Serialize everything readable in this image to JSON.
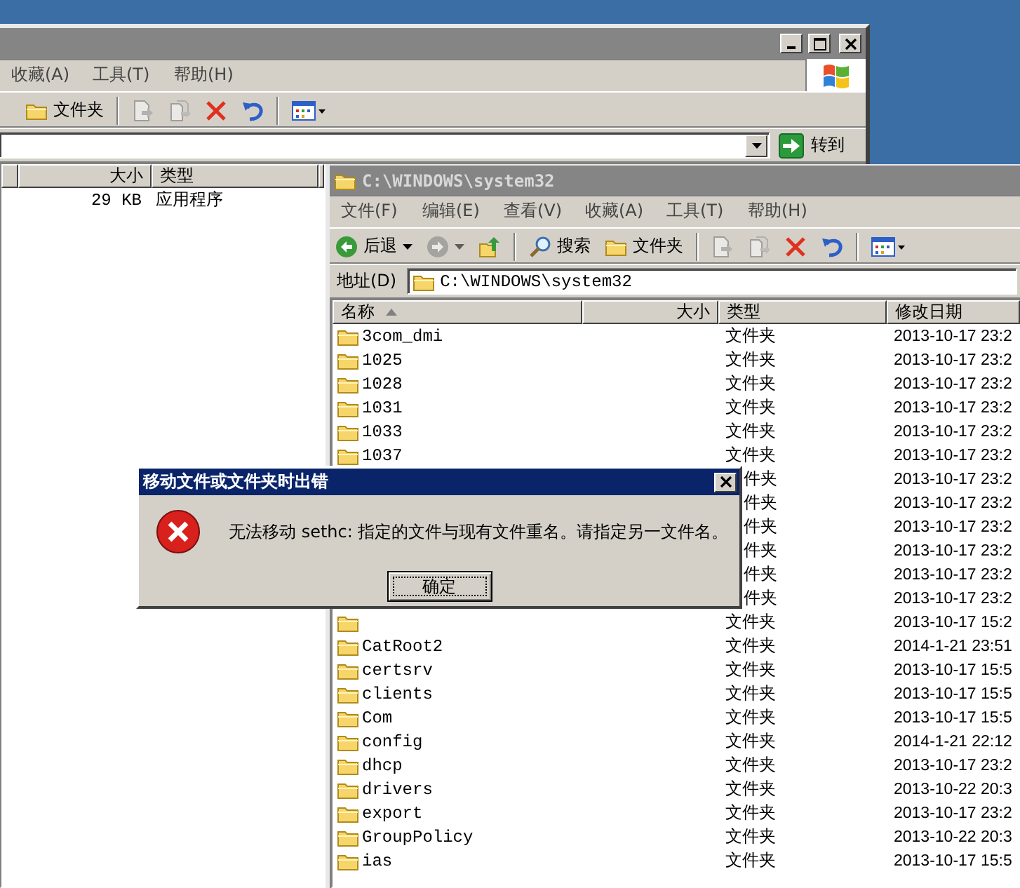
{
  "back_window": {
    "menus": [
      "收藏(A)",
      "工具(T)",
      "帮助(H)"
    ],
    "toolbar": [
      [
        {
          "kind": "folders",
          "label": "文件夹",
          "disabled": false
        }
      ],
      [
        {
          "kind": "move-to",
          "disabled": true
        },
        {
          "kind": "copy-to",
          "disabled": true
        },
        {
          "kind": "delete",
          "disabled": false
        },
        {
          "kind": "undo",
          "disabled": false
        }
      ],
      [
        {
          "kind": "views",
          "disabled": false
        }
      ]
    ],
    "go_button": "转到",
    "columns": [
      "大小",
      "类型"
    ],
    "rows": [
      {
        "size": "29 KB",
        "type": "应用程序"
      }
    ]
  },
  "window": {
    "title": "C:\\WINDOWS\\system32",
    "menus": [
      "文件(F)",
      "编辑(E)",
      "查看(V)",
      "收藏(A)",
      "工具(T)",
      "帮助(H)"
    ],
    "toolbar": [
      [
        {
          "kind": "back",
          "label": "后退",
          "disabled": false
        },
        {
          "kind": "forward",
          "disabled": true
        },
        {
          "kind": "up",
          "disabled": false
        }
      ],
      [
        {
          "kind": "search",
          "label": "搜索",
          "disabled": false
        },
        {
          "kind": "folders",
          "label": "文件夹",
          "disabled": false
        }
      ],
      [
        {
          "kind": "move-to",
          "disabled": true
        },
        {
          "kind": "copy-to",
          "disabled": true
        },
        {
          "kind": "delete",
          "disabled": false
        },
        {
          "kind": "undo",
          "disabled": false
        }
      ],
      [
        {
          "kind": "views",
          "disabled": false
        }
      ]
    ],
    "address_label": "地址(D)",
    "address": "C:\\WINDOWS\\system32",
    "columns": [
      {
        "label": "名称",
        "sorted": true
      },
      {
        "label": "大小",
        "sorted": false
      },
      {
        "label": "类型",
        "sorted": false
      },
      {
        "label": "修改日期",
        "sorted": false
      }
    ],
    "rows": [
      {
        "kind": "folder",
        "name": "3com_dmi",
        "type": "文件夹",
        "modified": "2013-10-17 23:2"
      },
      {
        "kind": "folder",
        "name": "1025",
        "type": "文件夹",
        "modified": "2013-10-17 23:2"
      },
      {
        "kind": "folder",
        "name": "1028",
        "type": "文件夹",
        "modified": "2013-10-17 23:2"
      },
      {
        "kind": "folder",
        "name": "1031",
        "type": "文件夹",
        "modified": "2013-10-17 23:2"
      },
      {
        "kind": "folder",
        "name": "1033",
        "type": "文件夹",
        "modified": "2013-10-17 23:2"
      },
      {
        "kind": "folder",
        "name": "1037",
        "type": "文件夹",
        "modified": "2013-10-17 23:2"
      },
      {
        "kind": "covered",
        "type": "件夹",
        "modified": "2013-10-17 23:2"
      },
      {
        "kind": "covered",
        "type": "件夹",
        "modified": "2013-10-17 23:2"
      },
      {
        "kind": "covered",
        "type": "件夹",
        "modified": "2013-10-17 23:2"
      },
      {
        "kind": "covered",
        "type": "件夹",
        "modified": "2013-10-17 23:2"
      },
      {
        "kind": "covered",
        "type": "件夹",
        "modified": "2013-10-17 23:2"
      },
      {
        "kind": "covered",
        "type": "件夹",
        "modified": "2013-10-17 23:2"
      },
      {
        "kind": "folder",
        "type": "文件夹",
        "modified": "2013-10-17 15:2"
      },
      {
        "kind": "folder",
        "name": "CatRoot2",
        "type": "文件夹",
        "modified": "2014-1-21 23:51"
      },
      {
        "kind": "folder",
        "name": "certsrv",
        "type": "文件夹",
        "modified": "2013-10-17 15:5"
      },
      {
        "kind": "folder",
        "name": "clients",
        "type": "文件夹",
        "modified": "2013-10-17 15:5"
      },
      {
        "kind": "folder",
        "name": "Com",
        "type": "文件夹",
        "modified": "2013-10-17 15:5"
      },
      {
        "kind": "folder",
        "name": "config",
        "type": "文件夹",
        "modified": "2014-1-21 22:12"
      },
      {
        "kind": "folder",
        "name": "dhcp",
        "type": "文件夹",
        "modified": "2013-10-17 23:2"
      },
      {
        "kind": "folder",
        "name": "drivers",
        "type": "文件夹",
        "modified": "2013-10-22 20:3"
      },
      {
        "kind": "folder",
        "name": "export",
        "type": "文件夹",
        "modified": "2013-10-17 23:2"
      },
      {
        "kind": "folder",
        "name": "GroupPolicy",
        "type": "文件夹",
        "modified": "2013-10-22 20:3"
      },
      {
        "kind": "folder",
        "name": "ias",
        "type": "文件夹",
        "modified": "2013-10-17 15:5"
      }
    ]
  },
  "dialog": {
    "title": "移动文件或文件夹时出错",
    "message": "无法移动 sethc: 指定的文件与现有文件重名。请指定另一文件名。",
    "button": "确定"
  }
}
